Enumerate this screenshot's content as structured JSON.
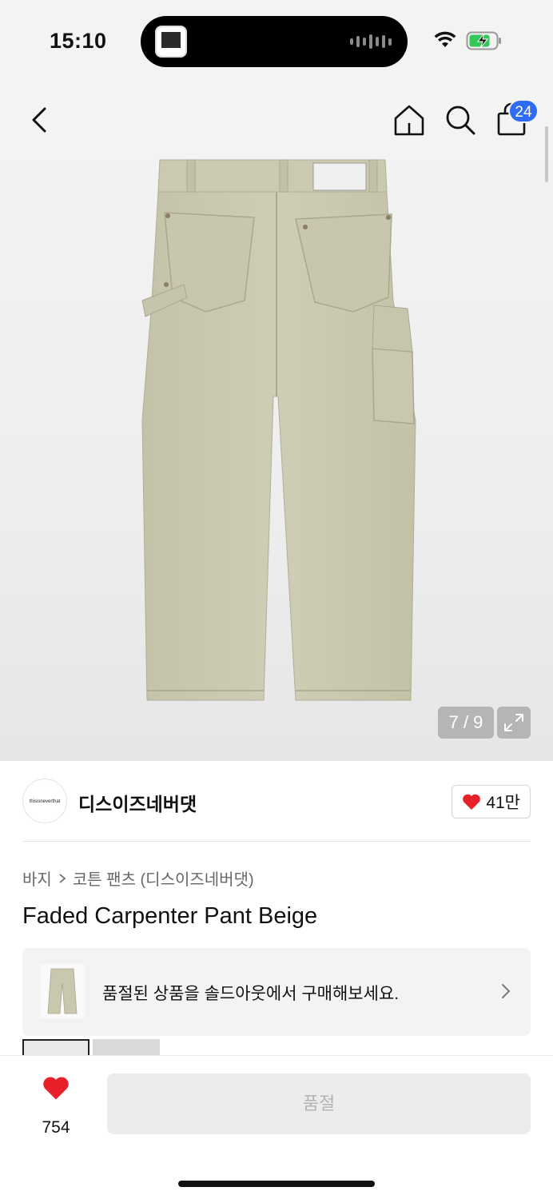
{
  "status": {
    "time": "15:10"
  },
  "header": {
    "cart_count": "24"
  },
  "gallery": {
    "counter": "7 / 9"
  },
  "brand": {
    "logo_text": "thisisneverthat",
    "name": "디스이즈네버댓",
    "likes": "41만"
  },
  "breadcrumb": {
    "category": "바지",
    "subcategory": "코튼 팬츠 (디스이즈네버댓)"
  },
  "product": {
    "title": "Faded Carpenter Pant Beige"
  },
  "soldout_banner": {
    "text": "품절된 상품을 솔드아웃에서 구매해보세요."
  },
  "bottom": {
    "like_count": "754",
    "buy_label": "품절"
  },
  "colors": {
    "accent_blue": "#2f6cf6",
    "heart_red": "#e8202a",
    "pants_beige": "#c9c7ad"
  }
}
